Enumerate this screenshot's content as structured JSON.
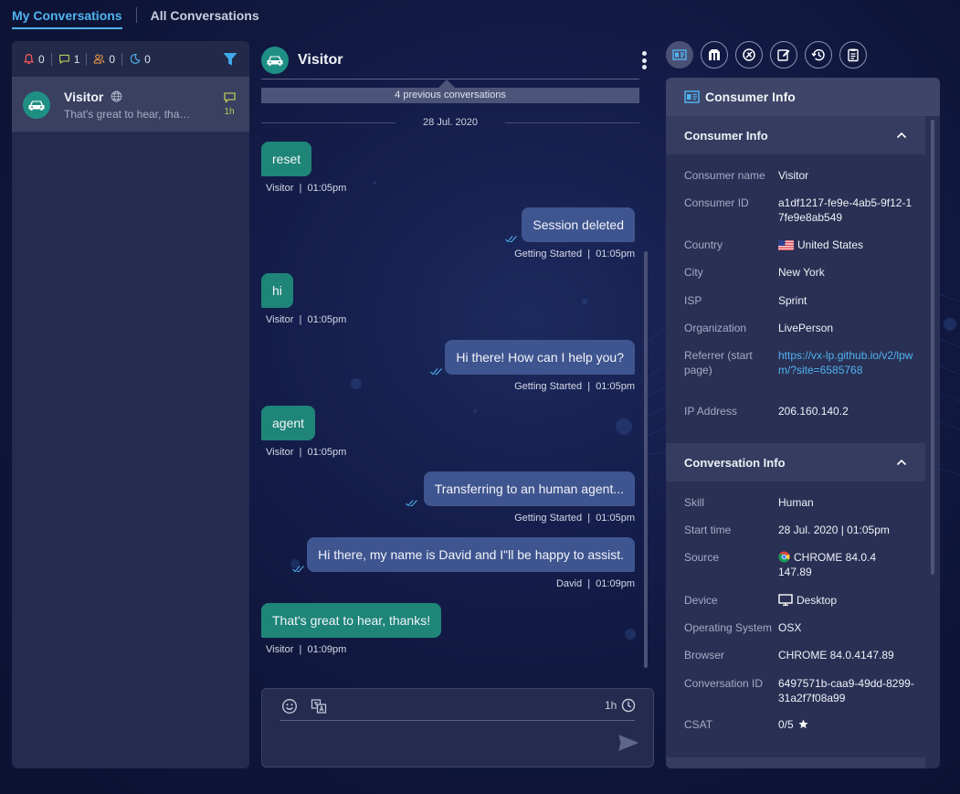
{
  "top_tabs": {
    "my": "My Conversations",
    "all": "All Conversations"
  },
  "counters": {
    "alerts": "0",
    "messages": "1",
    "agents": "0",
    "sleeping": "0"
  },
  "conversation_list": [
    {
      "name": "Visitor",
      "preview": "That's great to hear, thanks!",
      "time": "1h"
    }
  ],
  "chat": {
    "title": "Visitor",
    "previous_conversations": "4 previous conversations",
    "date": "28 Jul. 2020",
    "messages": [
      {
        "side": "visitor",
        "text": "reset",
        "sender": "Visitor",
        "time": "01:05pm"
      },
      {
        "side": "agent",
        "text": "Session deleted",
        "sender": "Getting Started",
        "time": "01:05pm"
      },
      {
        "side": "visitor",
        "text": "hi",
        "sender": "Visitor",
        "time": "01:05pm"
      },
      {
        "side": "agent",
        "text": "Hi there! How can I help you?",
        "sender": "Getting Started",
        "time": "01:05pm"
      },
      {
        "side": "visitor",
        "text": "agent",
        "sender": "Visitor",
        "time": "01:05pm"
      },
      {
        "side": "agent",
        "text": "Transferring to an human agent...",
        "sender": "Getting Started",
        "time": "01:05pm"
      },
      {
        "side": "agent",
        "text": "Hi there, my name is David and I\"ll be happy to assist.",
        "sender": "David",
        "time": "01:09pm"
      },
      {
        "side": "visitor",
        "text": "That's great to hear, thanks!",
        "sender": "Visitor",
        "time": "01:09pm"
      }
    ],
    "separator": "|",
    "composer_time": "1h"
  },
  "right_panel": {
    "title": "Consumer Info",
    "consumer_section": "Consumer Info",
    "consumer_rows": [
      {
        "label": "Consumer name",
        "value": "Visitor"
      },
      {
        "label": "Consumer ID",
        "value": "a1df1217-fe9e-4ab5-9f12-17fe9e8ab549"
      },
      {
        "label": "Country",
        "value": "United States"
      },
      {
        "label": "City",
        "value": "New York"
      },
      {
        "label": "ISP",
        "value": "Sprint"
      },
      {
        "label": "Organization",
        "value": "LivePerson"
      },
      {
        "label": "Referrer (start page)",
        "value": "https://vx-lp.github.io/v2/lpwm/?site=6585768"
      },
      {
        "label": "IP Address",
        "value": "206.160.140.2"
      }
    ],
    "conversation_section": "Conversation Info",
    "conversation_rows": [
      {
        "label": "Skill",
        "value": "Human"
      },
      {
        "label": "Start time",
        "value": "28 Jul. 2020 | 01:05pm"
      },
      {
        "label": "Source",
        "value": "CHROME 84.0.4147.89"
      },
      {
        "label": "Device",
        "value": "Desktop"
      },
      {
        "label": "Operating System",
        "value": "OSX"
      },
      {
        "label": "Browser",
        "value": "CHROME 84.0.4147.89"
      },
      {
        "label": "Conversation ID",
        "value": "6497571b-caa9-49dd-8299-31a2f7f08a99"
      },
      {
        "label": "CSAT",
        "value": "0/5"
      }
    ]
  },
  "colors": {
    "accent": "#4fb3f0",
    "visitor_bubble": "#1e8578",
    "agent_bubble": "#3f5590",
    "panel": "#252b4e"
  },
  "icons": {
    "tools": [
      "consumer-info-icon",
      "engagement-icon",
      "widget-icon",
      "notes-icon",
      "history-icon",
      "clipboard-icon"
    ]
  }
}
